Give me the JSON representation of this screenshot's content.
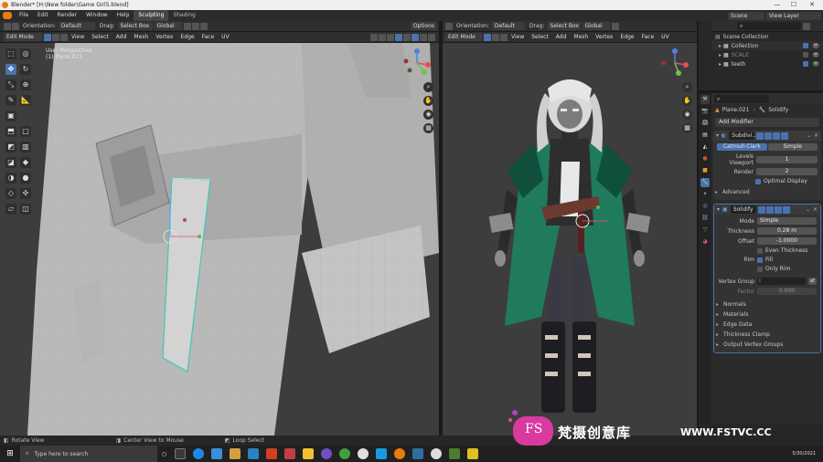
{
  "titlebar": {
    "title": "Blender* [H:\\New folder\\Game Girl5.blend]",
    "minimize": "—",
    "maximize": "☐",
    "close": "✕"
  },
  "menubar": {
    "items": [
      "File",
      "Edit",
      "Render",
      "Window",
      "Help"
    ],
    "workspaces": [
      "Sculpting",
      "Shading"
    ],
    "scene_label": "Scene",
    "view_layer_label": "View Layer"
  },
  "left_header": {
    "row1": {
      "orientation_label": "Orientation:",
      "orientation_value": "Default",
      "drag_label": "Drag:",
      "drag_value": "Select Box",
      "transform_space": "Global",
      "options": "Options"
    },
    "row2": {
      "mode": "Edit Mode",
      "menus": [
        "View",
        "Select",
        "Add",
        "Mesh",
        "Vertex",
        "Edge",
        "Face",
        "UV"
      ]
    }
  },
  "right_header": {
    "row1": {
      "orientation_label": "Orientation:",
      "orientation_value": "Default",
      "drag_label": "Drag:",
      "drag_value": "Select Box",
      "transform_space": "Global"
    },
    "row2": {
      "mode": "Edit Mode",
      "menus": [
        "View",
        "Select",
        "Add",
        "Mesh",
        "Vertex",
        "Edge",
        "Face",
        "UV"
      ]
    }
  },
  "left_viewport": {
    "overlay_line1": "User Perspective",
    "overlay_line2": "(1) Plane.021"
  },
  "outliner": {
    "root": "Scene Collection",
    "items": [
      "Collection",
      "SCALE",
      "teeth"
    ]
  },
  "properties": {
    "object": "Plane.021",
    "modifier_name": "Solidify",
    "add_modifier": "Add Modifier",
    "subdiv": {
      "name": "Subdivi...",
      "tabs": [
        "Catmull-Clark",
        "Simple"
      ],
      "levels_viewport_label": "Levels Viewport",
      "levels_viewport": "1",
      "render_label": "Render",
      "render": "2",
      "optimal_display": "Optimal Display",
      "advanced": "Advanced"
    },
    "solidify": {
      "name": "Solidify",
      "mode_label": "Mode",
      "mode": "Simple",
      "thickness_label": "Thickness",
      "thickness": "0.28 m",
      "offset_label": "Offset",
      "offset": "-1.0000",
      "even_thickness": "Even Thickness",
      "rim_label": "Rim",
      "fill": "Fill",
      "only_rim": "Only Rim",
      "vertex_group_label": "Vertex Group",
      "factor_label": "Factor",
      "factor": "0.000",
      "subpanels": [
        "Normals",
        "Materials",
        "Edge Data",
        "Thickness Clamp",
        "Output Vertex Groups"
      ]
    }
  },
  "statusbar": {
    "left": "Rotate View",
    "middle": "Center View to Mouse",
    "right": "Loop Select"
  },
  "taskbar": {
    "search_placeholder": "Type here to search",
    "date": "5/30/2021"
  },
  "watermark": {
    "logo": "FS",
    "cn_text": "梵摄创意库",
    "url": "WWW.FSTVC.CC"
  },
  "colors": {
    "accent": "#4a72b0",
    "coat": "#1f7a5e",
    "header": "#2f2f2f",
    "viewport": "#3d3d3d"
  }
}
